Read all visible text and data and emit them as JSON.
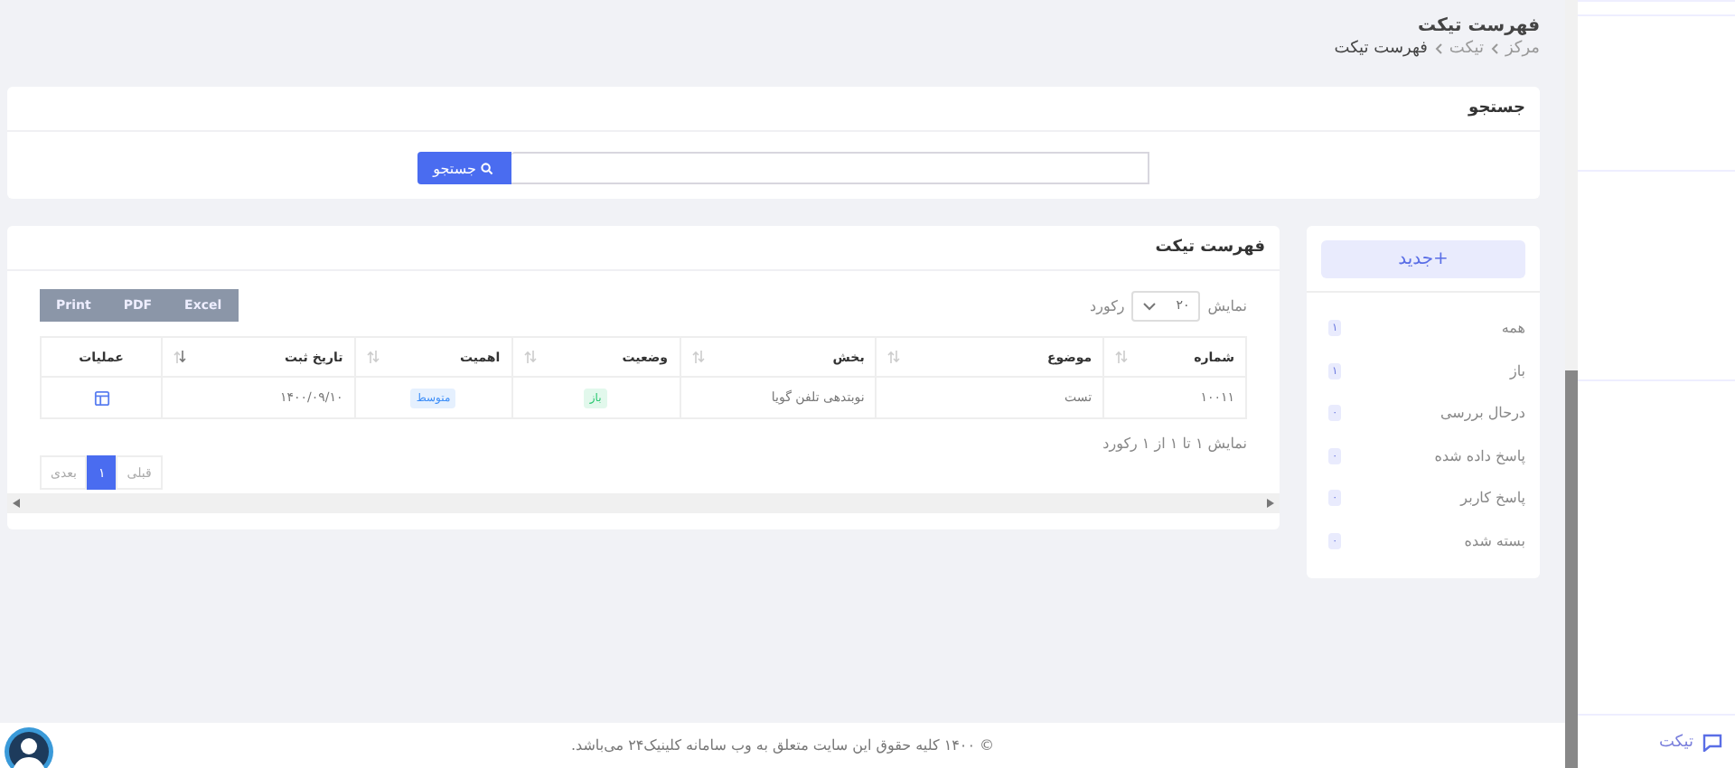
{
  "page": {
    "title": "فهرست تیکت",
    "breadcrumb": [
      {
        "label": "مرکز",
        "current": false
      },
      {
        "label": "تیکت",
        "current": false
      },
      {
        "label": "فهرست تیکت",
        "current": true
      }
    ]
  },
  "search": {
    "title": "جستجو",
    "button": "جستجو"
  },
  "filters": {
    "new_button": "+جدید",
    "items": [
      {
        "label": "همه",
        "count": "۱"
      },
      {
        "label": "باز",
        "count": "۱"
      },
      {
        "label": "درحال بررسی",
        "count": "۰"
      },
      {
        "label": "پاسخ داده شده",
        "count": "۰"
      },
      {
        "label": "پاسخ کاربر",
        "count": "۰"
      },
      {
        "label": "بسته شده",
        "count": "۰"
      }
    ]
  },
  "tickets": {
    "title": "فهرست تیکت",
    "length_before": "نمایش",
    "length_value": "۲۰",
    "length_after": "رکورد",
    "export_buttons": [
      "Excel",
      "PDF",
      "Print"
    ],
    "columns": [
      {
        "label": "شماره",
        "kind": "sortable"
      },
      {
        "label": "موضوع",
        "kind": "sortable"
      },
      {
        "label": "بخش",
        "kind": "sortable"
      },
      {
        "label": "وضعیت",
        "kind": "sortable"
      },
      {
        "label": "اهمیت",
        "kind": "sortable"
      },
      {
        "label": "تاریخ ثبت",
        "kind": "sorted"
      },
      {
        "label": "عملیات",
        "kind": "plain"
      }
    ],
    "rows": [
      {
        "cells": [
          {
            "kind": "text",
            "text": "۱۰۰۱۱"
          },
          {
            "kind": "text",
            "text": "تست"
          },
          {
            "kind": "text",
            "text": "نوبتدهی تلفن گویا"
          },
          {
            "kind": "badge",
            "text": "باز",
            "color": "#28c76f"
          },
          {
            "kind": "badge",
            "text": "متوسط",
            "color": "#3d8ef8"
          },
          {
            "kind": "text",
            "text": "۱۴۰۰/۰۹/۱۰"
          },
          {
            "kind": "action"
          }
        ]
      }
    ],
    "info": "نمایش ۱ تا ۱ از ۱ رکورد",
    "pagination": {
      "prev": "قبلی",
      "pages": [
        {
          "label": "۱",
          "selected": true
        }
      ],
      "next": "بعدی"
    }
  },
  "footer": {
    "text": "© ۱۴۰۰ کلیه حقوق این سایت متعلق به وب سامانه کلینیک۲۴ می‌باشد."
  },
  "nav": [
    {
      "label": "تیکت"
    }
  ]
}
